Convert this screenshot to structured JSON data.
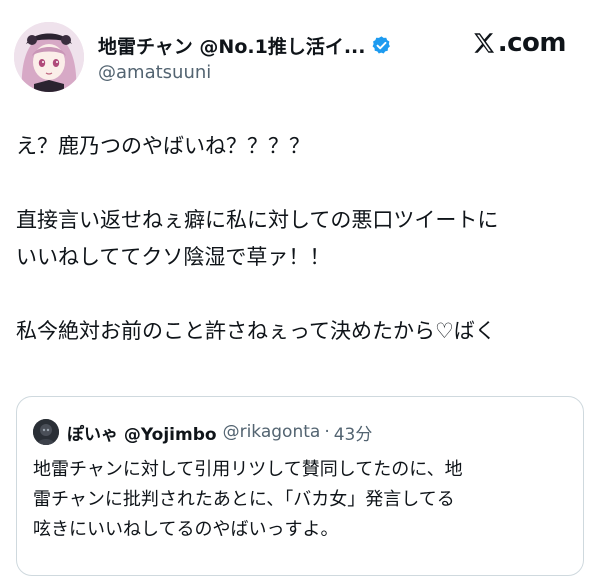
{
  "author": {
    "display_name": "地雷チャン @No.1推し活イ...",
    "handle": "@amatsuuni",
    "verified": true,
    "avatar_icon": "anime-girl-avatar-icon"
  },
  "site": {
    "label": ".com",
    "logo_icon": "x-logo-icon"
  },
  "tweet": {
    "lines": [
      "え？鹿乃つのやばいね？？？？",
      "",
      "直接言い返せねぇ癖に私に対しての悪口ツイートに",
      "いいねしててクソ陰湿で草ァ！！",
      "",
      "私今絶対お前のこと許さねぇって決めたから♡ばく"
    ]
  },
  "quote": {
    "avatar_icon": "dark-avatar-icon",
    "display_name": "ぽいゃ @Yojimbo",
    "handle": "@rikagonta",
    "separator": "·",
    "time": "43分",
    "lines": [
      "地雷チャンに対して引用リツして賛同してたのに、地",
      "雷チャンに批判されたあとに、「バカ女」発言してる",
      "呟きにいいねしてるのやばいっすよ。"
    ]
  },
  "colors": {
    "text": "#0f1419",
    "secondary": "#536471",
    "verified": "#1d9bf0",
    "border": "#cfd9de"
  }
}
